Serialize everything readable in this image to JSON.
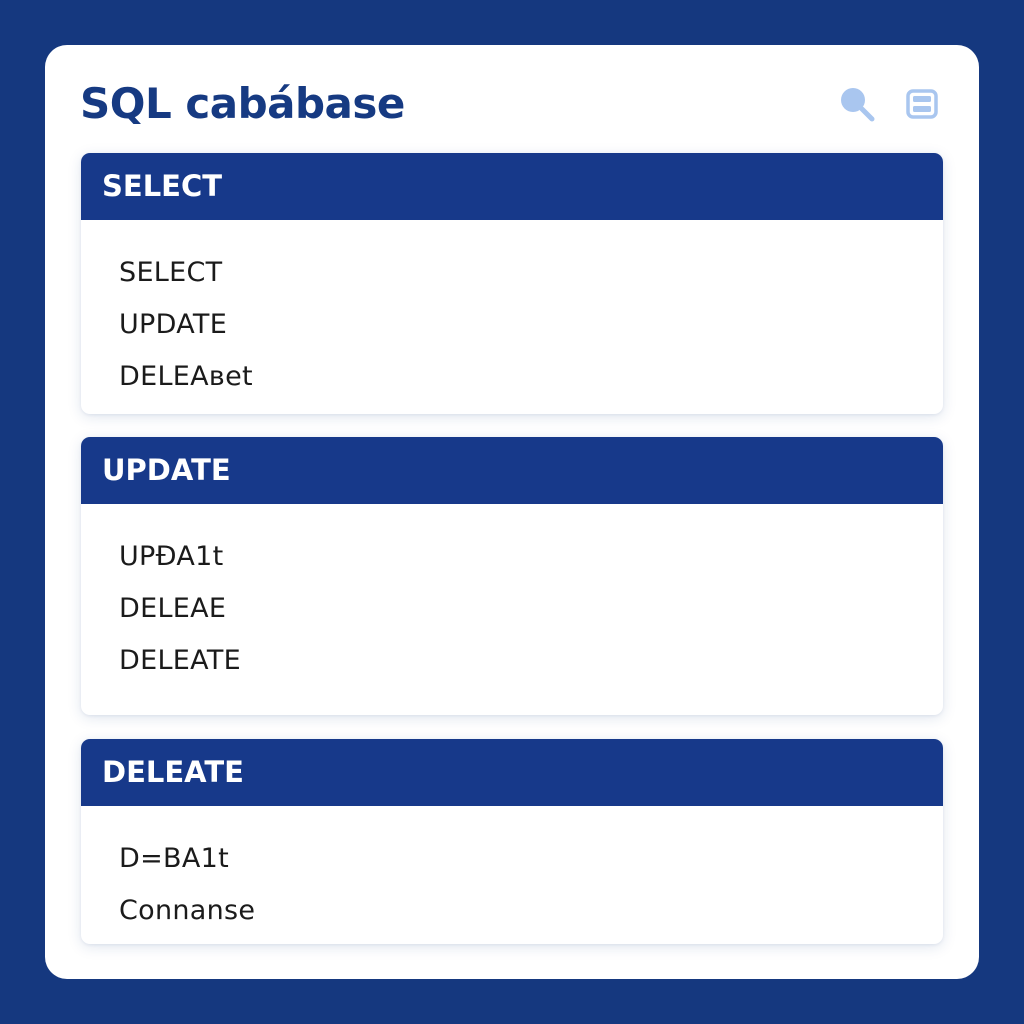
{
  "app": {
    "title": "SQL cabábase"
  },
  "toolbar": {
    "search_icon": "search-icon",
    "panel_icon": "panel-icon",
    "icon_color": "#a9c6ef"
  },
  "colors": {
    "background": "#15387f",
    "header": "#17398a",
    "title": "#163a82"
  },
  "sections": [
    {
      "header": "SELECT",
      "items": [
        "SELECT",
        "UPDATE",
        "DELEAвet"
      ]
    },
    {
      "header": "UPDATE",
      "items": [
        "UPÐA1t",
        "DELEAE",
        "DELEATE"
      ]
    },
    {
      "header": "DELEATE",
      "items": [
        "D=BA1t",
        "Connanse"
      ]
    }
  ]
}
